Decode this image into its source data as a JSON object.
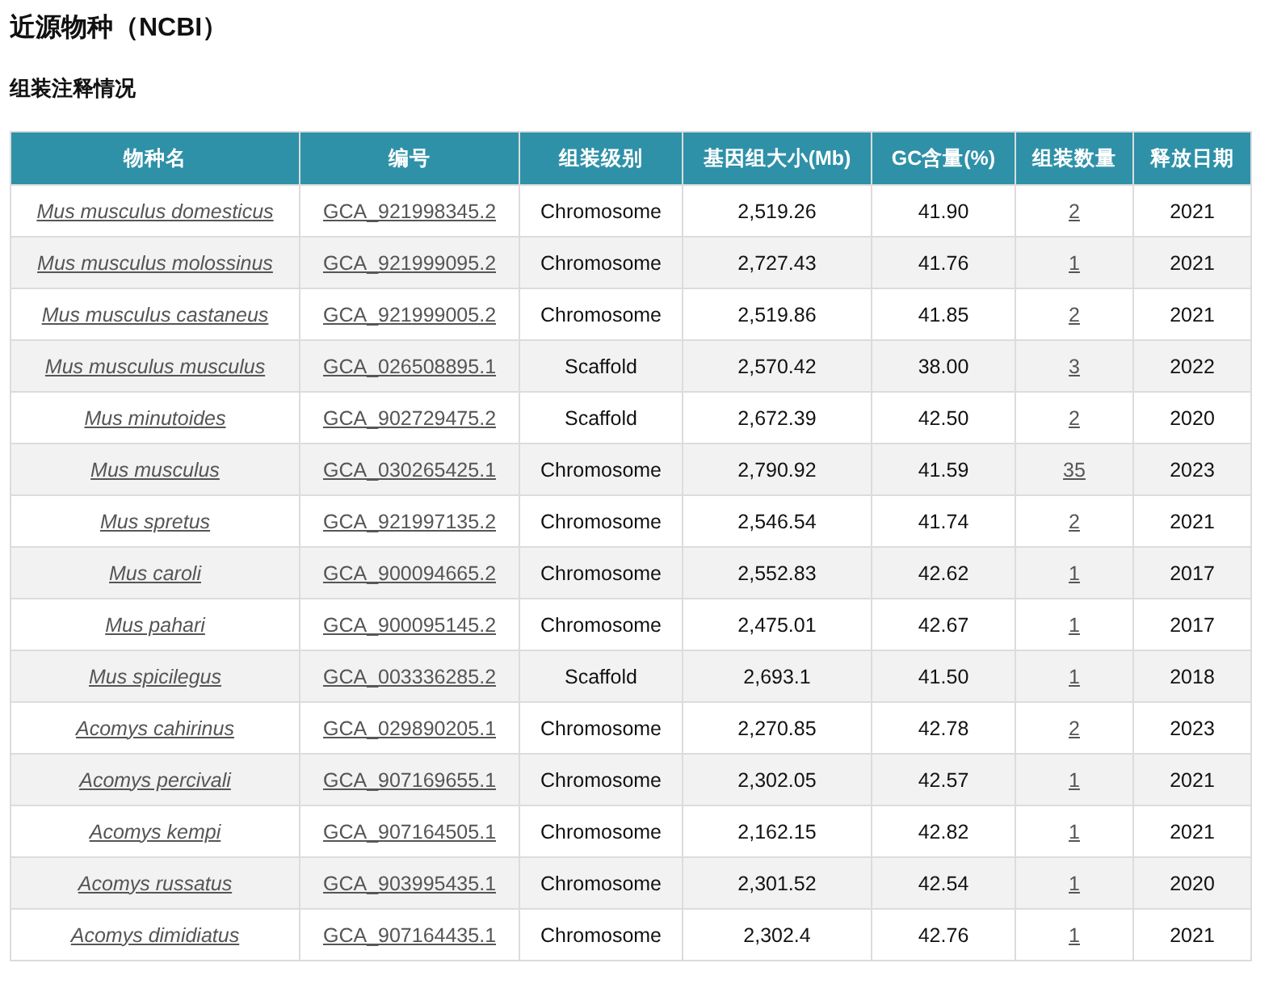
{
  "title": "近源物种（NCBI）",
  "subtitle": "组装注释情况",
  "table": {
    "columns": [
      "物种名",
      "编号",
      "组装级别",
      "基因组大小(Mb)",
      "GC含量(%)",
      "组装数量",
      "释放日期"
    ],
    "rows": [
      {
        "species": "Mus musculus domesticus",
        "accession": "GCA_921998345.2",
        "level": "Chromosome",
        "size": "2,519.26",
        "gc": "41.90",
        "count": "2",
        "year": "2021"
      },
      {
        "species": "Mus musculus molossinus",
        "accession": "GCA_921999095.2",
        "level": "Chromosome",
        "size": "2,727.43",
        "gc": "41.76",
        "count": "1",
        "year": "2021"
      },
      {
        "species": "Mus musculus castaneus",
        "accession": "GCA_921999005.2",
        "level": "Chromosome",
        "size": "2,519.86",
        "gc": "41.85",
        "count": "2",
        "year": "2021"
      },
      {
        "species": "Mus musculus musculus",
        "accession": "GCA_026508895.1",
        "level": "Scaffold",
        "size": "2,570.42",
        "gc": "38.00",
        "count": "3",
        "year": "2022"
      },
      {
        "species": "Mus minutoides",
        "accession": "GCA_902729475.2",
        "level": "Scaffold",
        "size": "2,672.39",
        "gc": "42.50",
        "count": "2",
        "year": "2020"
      },
      {
        "species": "Mus musculus",
        "accession": "GCA_030265425.1",
        "level": "Chromosome",
        "size": "2,790.92",
        "gc": "41.59",
        "count": "35",
        "year": "2023"
      },
      {
        "species": "Mus spretus",
        "accession": "GCA_921997135.2",
        "level": "Chromosome",
        "size": "2,546.54",
        "gc": "41.74",
        "count": "2",
        "year": "2021"
      },
      {
        "species": "Mus caroli",
        "accession": "GCA_900094665.2",
        "level": "Chromosome",
        "size": "2,552.83",
        "gc": "42.62",
        "count": "1",
        "year": "2017"
      },
      {
        "species": "Mus pahari",
        "accession": "GCA_900095145.2",
        "level": "Chromosome",
        "size": "2,475.01",
        "gc": "42.67",
        "count": "1",
        "year": "2017"
      },
      {
        "species": "Mus spicilegus",
        "accession": "GCA_003336285.2",
        "level": "Scaffold",
        "size": "2,693.1",
        "gc": "41.50",
        "count": "1",
        "year": "2018"
      },
      {
        "species": "Acomys cahirinus",
        "accession": "GCA_029890205.1",
        "level": "Chromosome",
        "size": "2,270.85",
        "gc": "42.78",
        "count": "2",
        "year": "2023"
      },
      {
        "species": "Acomys percivali",
        "accession": "GCA_907169655.1",
        "level": "Chromosome",
        "size": "2,302.05",
        "gc": "42.57",
        "count": "1",
        "year": "2021"
      },
      {
        "species": "Acomys kempi",
        "accession": "GCA_907164505.1",
        "level": "Chromosome",
        "size": "2,162.15",
        "gc": "42.82",
        "count": "1",
        "year": "2021"
      },
      {
        "species": "Acomys russatus",
        "accession": "GCA_903995435.1",
        "level": "Chromosome",
        "size": "2,301.52",
        "gc": "42.54",
        "count": "1",
        "year": "2020"
      },
      {
        "species": "Acomys dimidiatus",
        "accession": "GCA_907164435.1",
        "level": "Chromosome",
        "size": "2,302.4",
        "gc": "42.76",
        "count": "1",
        "year": "2021"
      }
    ]
  }
}
